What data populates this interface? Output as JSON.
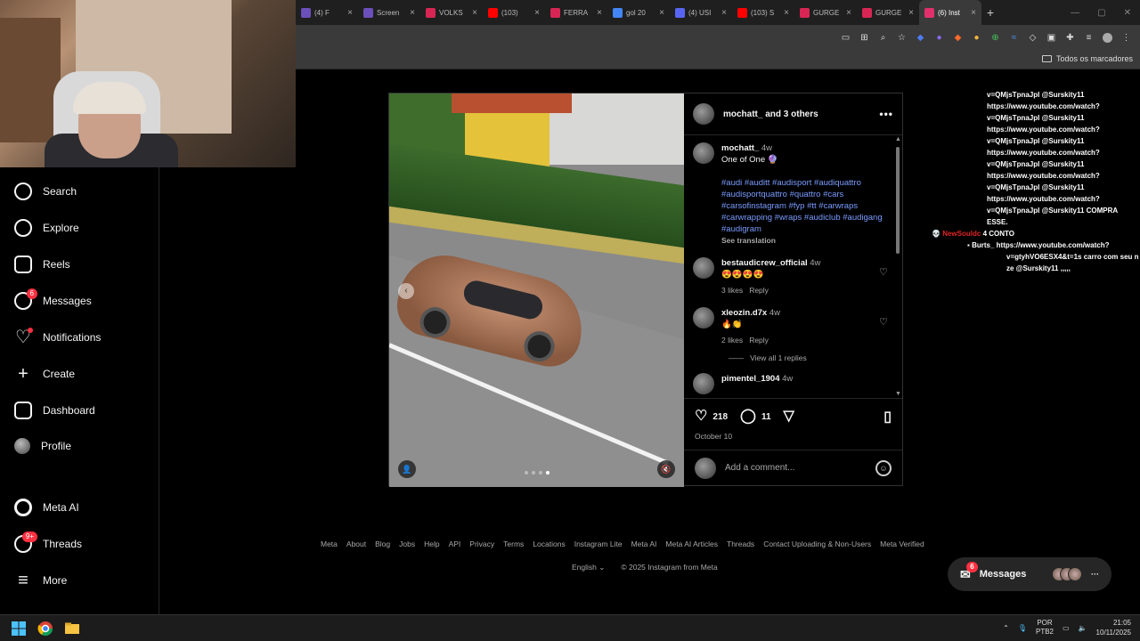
{
  "tabs": [
    {
      "label": "(4) F",
      "color": "#6b4fbb"
    },
    {
      "label": "Screen",
      "color": "#6b4fbb"
    },
    {
      "label": "VOLKS",
      "color": "#d72654"
    },
    {
      "label": "(103)",
      "color": "#ff0000"
    },
    {
      "label": "FERRA",
      "color": "#d72654"
    },
    {
      "label": "gol 20",
      "color": "#4285f4"
    },
    {
      "label": "(4) USI",
      "color": "#5865f2"
    },
    {
      "label": "(103) S",
      "color": "#ff0000"
    },
    {
      "label": "GURGE",
      "color": "#d72654"
    },
    {
      "label": "GURGE",
      "color": "#d72654"
    },
    {
      "label": "(6) Inst",
      "color": "#e1306c",
      "active": true
    }
  ],
  "bookmarks": {
    "all_label": "Todos os marcadores"
  },
  "sidebar": {
    "items": [
      {
        "label": "Search",
        "icon": "search-icon"
      },
      {
        "label": "Explore",
        "icon": "compass-icon"
      },
      {
        "label": "Reels",
        "icon": "reels-icon"
      },
      {
        "label": "Messages",
        "icon": "messenger-icon",
        "badge": "6"
      },
      {
        "label": "Notifications",
        "icon": "heart-icon"
      },
      {
        "label": "Create",
        "icon": "plus-icon"
      },
      {
        "label": "Dashboard",
        "icon": "chart-icon"
      },
      {
        "label": "Profile",
        "icon": "avatar-icon"
      },
      {
        "label": "Meta AI",
        "icon": "meta-ai-icon"
      },
      {
        "label": "Threads",
        "icon": "threads-icon",
        "badge": "9+"
      },
      {
        "label": "More",
        "icon": "menu-icon"
      }
    ]
  },
  "post": {
    "header": "mochatt_ and 3 others",
    "caption": {
      "user": "mochatt_",
      "time": "4w",
      "text": "One of One 🔮",
      "hashtags": "#audi #auditt #audisport #audiquattro #audisportquattro #quattro #cars #carsofinstagram #fyp #tt #carwraps #carwrapping #wraps #audiclub #audigang #audigram",
      "see_translation": "See translation"
    },
    "comments": [
      {
        "user": "bestaudicrew_official",
        "time": "4w",
        "text": "😍😍😍😍",
        "likes": "3 likes",
        "reply": "Reply"
      },
      {
        "user": "xleozin.d7x",
        "time": "4w",
        "text": "🔥👏",
        "likes": "2 likes",
        "reply": "Reply",
        "view_replies": "View all 1 replies"
      },
      {
        "user": "pimentel_1904",
        "time": "4w",
        "text": ""
      }
    ],
    "like_count": "218",
    "comment_count": "11",
    "date": "October 10",
    "add_comment_placeholder": "Add a comment..."
  },
  "footer": {
    "links": [
      "Meta",
      "About",
      "Blog",
      "Jobs",
      "Help",
      "API",
      "Privacy",
      "Terms",
      "Locations",
      "Instagram Lite",
      "Meta AI",
      "Meta AI Articles",
      "Threads",
      "Contact Uploading & Non-Users",
      "Meta Verified"
    ],
    "language": "English",
    "copyright": "© 2025 Instagram from Meta"
  },
  "chat": {
    "lines": [
      "v=QMjsTpnaJpI @Surskity11",
      "https://www.youtube.com/watch?",
      "v=QMjsTpnaJpI @Surskity11",
      "https://www.youtube.com/watch?",
      "v=QMjsTpnaJpI @Surskity11",
      "https://www.youtube.com/watch?",
      "v=QMjsTpnaJpI @Surskity11",
      "https://www.youtube.com/watch?",
      "v=QMjsTpnaJpI @Surskity11",
      "https://www.youtube.com/watch?",
      "v=QMjsTpnaJpI @Surskity11 COMPRA",
      "ESSE."
    ],
    "msg1_user": "NewSouldc",
    "msg1_text": "4 CONTO",
    "msg2_user": "Burts_",
    "msg2_lines": [
      "https://www.youtube.com/watch?",
      "v=gtyhVO6ESX4&t=1s carro com seu n",
      "ze @Surskity11 ,,,,,"
    ]
  },
  "messages_pill": {
    "label": "Messages",
    "badge": "6"
  },
  "taskbar": {
    "lang1": "POR",
    "lang2": "PTB2",
    "time": "21:05",
    "date": "10/11/2025"
  }
}
